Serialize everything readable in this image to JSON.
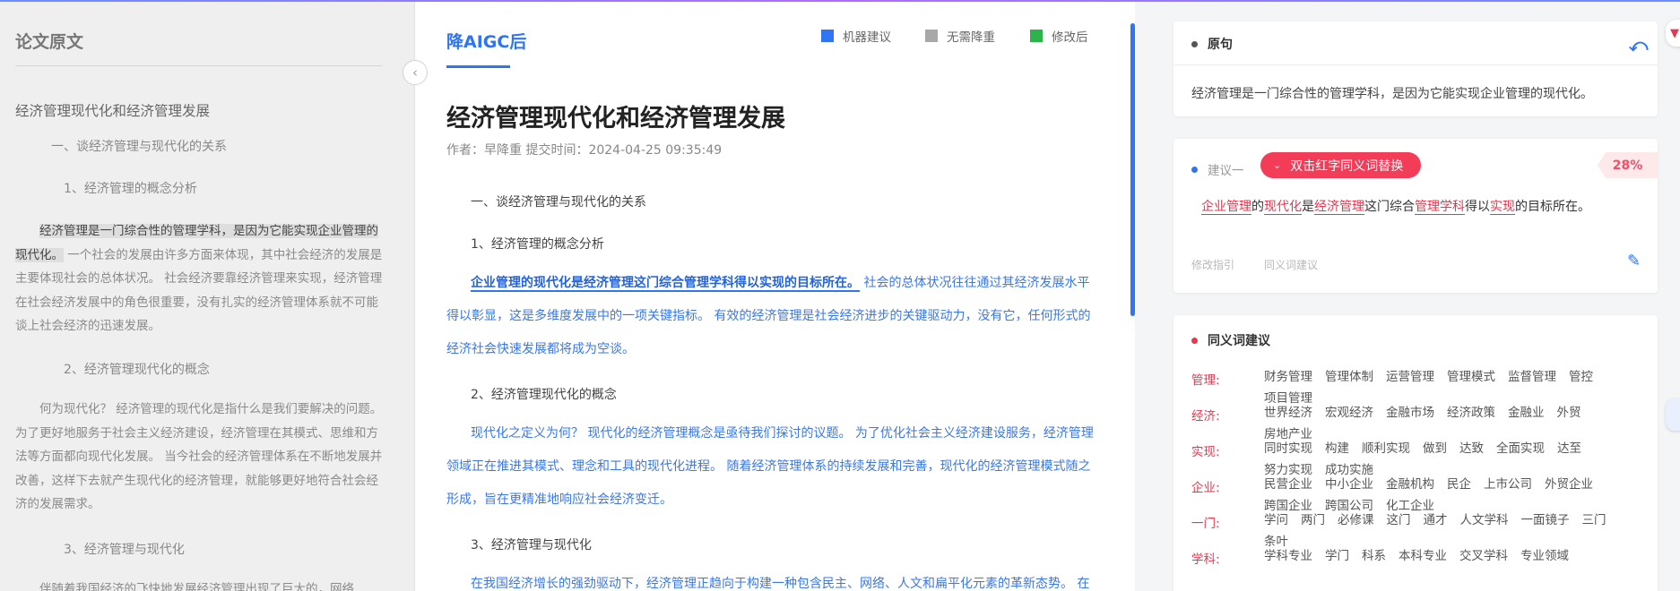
{
  "left": {
    "title": "论文原文",
    "doc_title": "经济管理现代化和经济管理发展",
    "h1": "一、谈经济管理与现代化的关系",
    "h1_1": "1、经济管理的概念分析",
    "p1_highlight": "经济管理是一门综合性的管理学科，是因为它能实现企业管理的现代化。",
    "p1_rest": "一个社会的发展由许多方面来体现，其中社会经济的发展是主要体现社会的总体状况。 社会经济要靠经济管理来实现，经济管理在社会经济发展中的角色很重要，没有扎实的经济管理体系就不可能谈上社会经济的迅速发展。",
    "h2": "2、经济管理现代化的概念",
    "p2": "何为现代化？ 经济管理的现代化是指什么是我们要解决的问题。 为了更好地服务于社会主义经济建设，经济管理在其模式、思维和方法等方面都向现代化发展。 当今社会的经济管理体系在不断地发展并改善，这样下去就产生现代化的经济管理，就能够更好地符合社会经济的发展需求。",
    "h3": "3、经济管理与现代化",
    "p3": "伴随着我国经济的飞快地发展经济管理出现了巨大的，网络"
  },
  "middle": {
    "tab": "降AIGC后",
    "legend": [
      {
        "label": "机器建议",
        "color": "#2f74f0"
      },
      {
        "label": "无需降重",
        "color": "#a8a8a8"
      },
      {
        "label": "修改后",
        "color": "#2cb34a"
      }
    ],
    "doc_title": "经济管理现代化和经济管理发展",
    "meta": "作者：早降重    提交时间：2024-04-25 09:35:49",
    "h1": "一、谈经济管理与现代化的关系",
    "h1_1": "1、经济管理的概念分析",
    "p1_under": "企业管理的现代化是经济管理这门综合管理学科得以实现的目标所在。",
    "p1_rest": "社会的总体状况往往通过其经济发展水平得以彰显，这是多维度发展中的一项关键指标。 有效的经济管理是社会经济进步的关键驱动力，没有它，任何形式的经济社会快速发展都将成为空谈。",
    "h2": "2、经济管理现代化的概念",
    "p2": "现代化之定义为何？ 现代化的经济管理概念是亟待我们探讨的议题。 为了优化社会主义经济建设服务，经济管理领域正在推进其模式、理念和工具的现代化进程。 随着经济管理体系的持续发展和完善，现代化的经济管理模式随之形成，旨在更精准地响应社会经济变迁。",
    "h3": "3、经济管理与现代化",
    "p3": "在我国经济增长的强劲驱动下，经济管理正趋向于构建一种包含民主、网络、人文和扁平化元素的革新态势。 在"
  },
  "right": {
    "original_label": "原句",
    "original_text": "经济管理是一门综合性的管理学科，是因为它能实现企业管理的现代化。",
    "suggestion_label": "建议一",
    "replace_button": "双击红字同义词替换",
    "percent": "28%",
    "suggestion_parts": [
      {
        "t": "企业管理",
        "r": true
      },
      {
        "t": "的",
        "r": false
      },
      {
        "t": "现代化",
        "r": true
      },
      {
        "t": "是",
        "r": false
      },
      {
        "t": "经济管理",
        "r": true
      },
      {
        "t": "这门综合",
        "r": false
      },
      {
        "t": "管理学科",
        "r": true
      },
      {
        "t": "得以",
        "r": false
      },
      {
        "t": "实现",
        "r": true
      },
      {
        "t": "的目标所在。",
        "r": false
      }
    ],
    "action_guide": "修改指引",
    "action_synonym": "同义词建议",
    "synonym_title": "同义词建议",
    "synonyms": [
      {
        "key": "管理:",
        "words": [
          "财务管理",
          "管理体制",
          "运营管理",
          "管理模式",
          "监督管理",
          "管控",
          "项目管理"
        ]
      },
      {
        "key": "经济:",
        "words": [
          "世界经济",
          "宏观经济",
          "金融市场",
          "经济政策",
          "金融业",
          "外贸",
          "房地产业"
        ]
      },
      {
        "key": "实现:",
        "words": [
          "同时实现",
          "构建",
          "顺利实现",
          "做到",
          "达致",
          "全面实现",
          "达至",
          "努力实现",
          "成功实施"
        ]
      },
      {
        "key": "企业:",
        "words": [
          "民营企业",
          "中小企业",
          "金融机构",
          "民企",
          "上市公司",
          "外贸企业",
          "跨国企业",
          "跨国公司",
          "化工企业"
        ]
      },
      {
        "key": "一门:",
        "words": [
          "学问",
          "两门",
          "必修课",
          "这门",
          "通才",
          "人文学科",
          "一面镜子",
          "三门",
          "条叶"
        ]
      },
      {
        "key": "学科:",
        "words": [
          "学科专业",
          "学门",
          "科系",
          "本科专业",
          "交叉学科",
          "专业领域"
        ]
      }
    ]
  }
}
